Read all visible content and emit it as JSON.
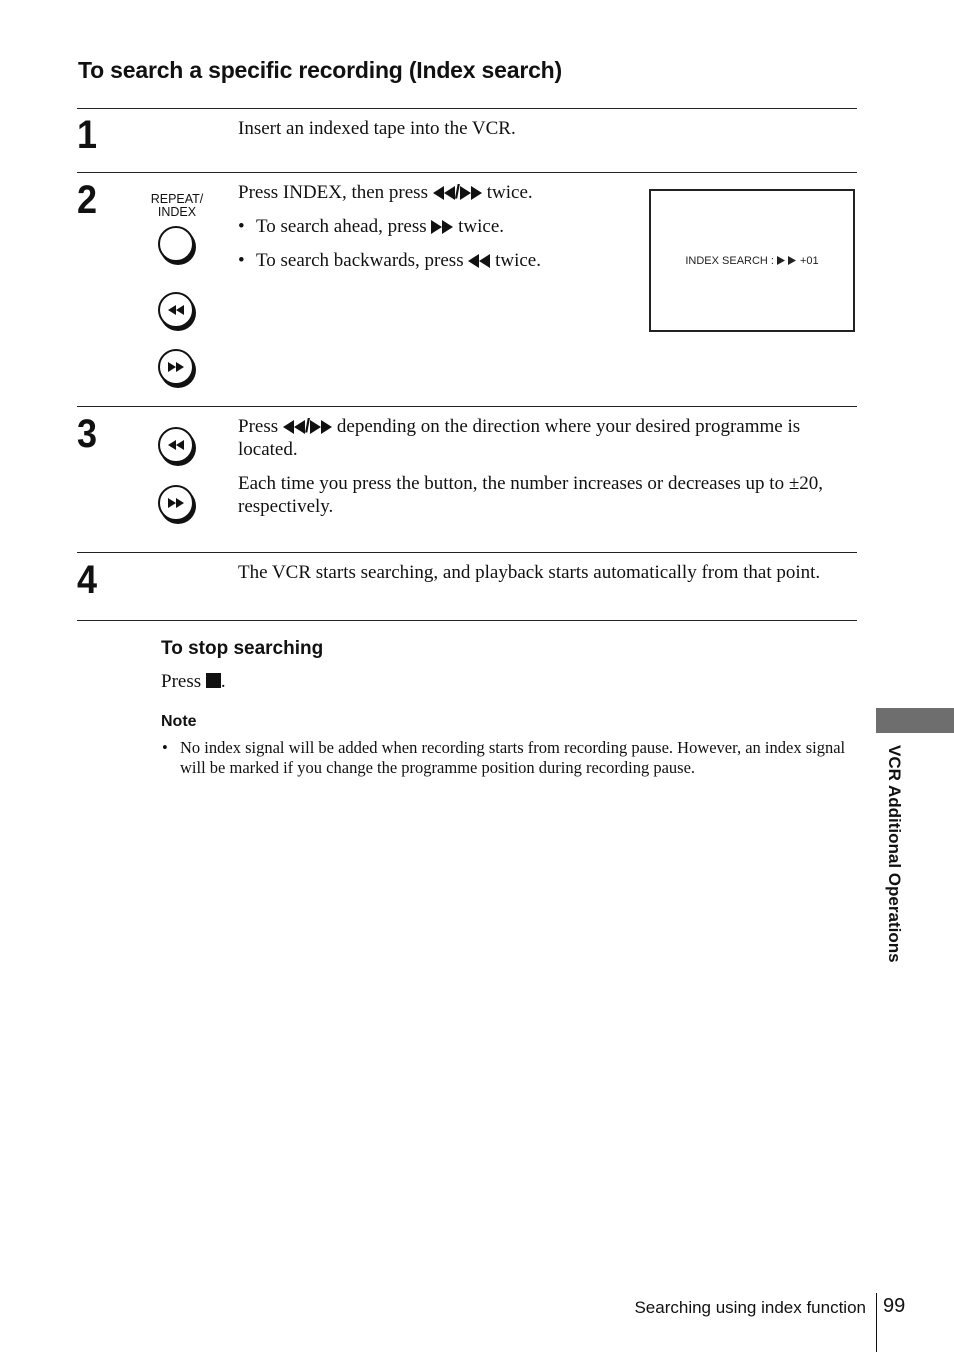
{
  "heading": "To search a specific recording (Index search)",
  "steps": [
    {
      "number": "1",
      "text": "Insert an indexed tape into the VCR."
    },
    {
      "number": "2",
      "button_label_line1": "REPEAT/",
      "button_label_line2": "INDEX",
      "text_before": "Press INDEX, then press ",
      "text_after": " twice.",
      "bullets": [
        {
          "before": "To search ahead, press ",
          "after": " twice."
        },
        {
          "before": "To search backwards, press ",
          "after": " twice."
        }
      ],
      "screen_display": {
        "label": "INDEX SEARCH :",
        "value": "+01"
      }
    },
    {
      "number": "3",
      "para1_before": "Press ",
      "para1_after": " depending on the direction where your desired programme is located.",
      "para2": "Each time you press the button, the number increases or decreases up to ±20, respectively."
    },
    {
      "number": "4",
      "text": "The VCR starts searching, and playback starts automatically from that point."
    }
  ],
  "stop": {
    "heading": "To stop searching",
    "text_before": "Press ",
    "text_after": "."
  },
  "note": {
    "heading": "Note",
    "bullet": "•",
    "text": "No index signal will be added when recording starts from recording pause.  However, an index signal will be marked if you change the programme position during recording pause."
  },
  "side_tab": {
    "label": "VCR Additional Operations",
    "color": "#6e6e6e"
  },
  "footer": {
    "section": "Searching using index function",
    "page": "99"
  },
  "icons": {
    "rewind": "rewind-icon",
    "fast_forward": "fast-forward-icon",
    "stop": "stop-icon",
    "slash": "/"
  }
}
